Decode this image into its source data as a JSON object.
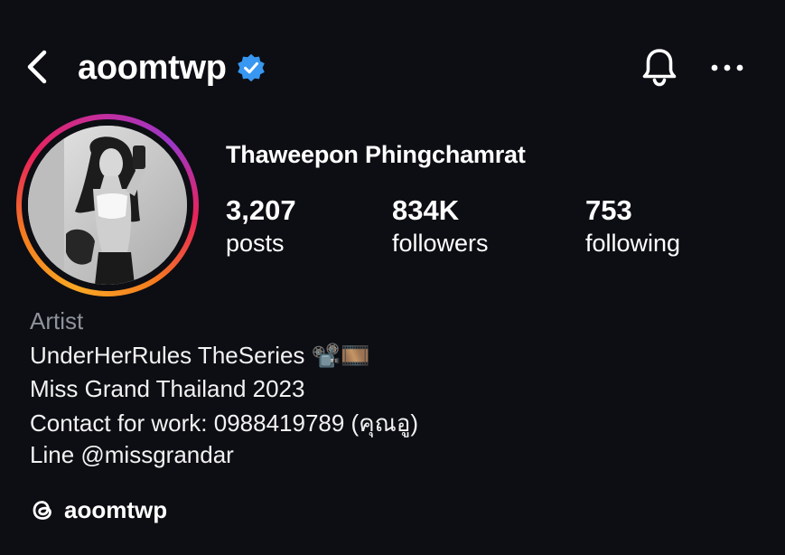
{
  "header": {
    "back_icon": "chevron-left-icon",
    "username": "aoomtwp",
    "verified_icon": "verified-badge-icon",
    "notification_icon": "bell-icon",
    "more_icon": "more-dots-icon",
    "verified_color": "#3897f0"
  },
  "profile": {
    "avatar": "profile-photo",
    "full_name": "Thaweepon Phingchamrat",
    "stats": [
      {
        "value": "3,207",
        "label": "posts"
      },
      {
        "value": "834K",
        "label": "followers"
      },
      {
        "value": "753",
        "label": "following"
      }
    ]
  },
  "bio": {
    "category": "Artist",
    "lines": [
      "UnderHerRules TheSeries 📽️🎞️",
      "Miss Grand Thailand 2023",
      "Contact for work: 0988419789 (คุณอู)",
      "Line @missgrandar"
    ]
  },
  "threads": {
    "icon": "threads-icon",
    "handle": "aoomtwp"
  },
  "colors": {
    "background": "#0c0e13",
    "text": "#ffffff",
    "muted": "#8e929a"
  }
}
